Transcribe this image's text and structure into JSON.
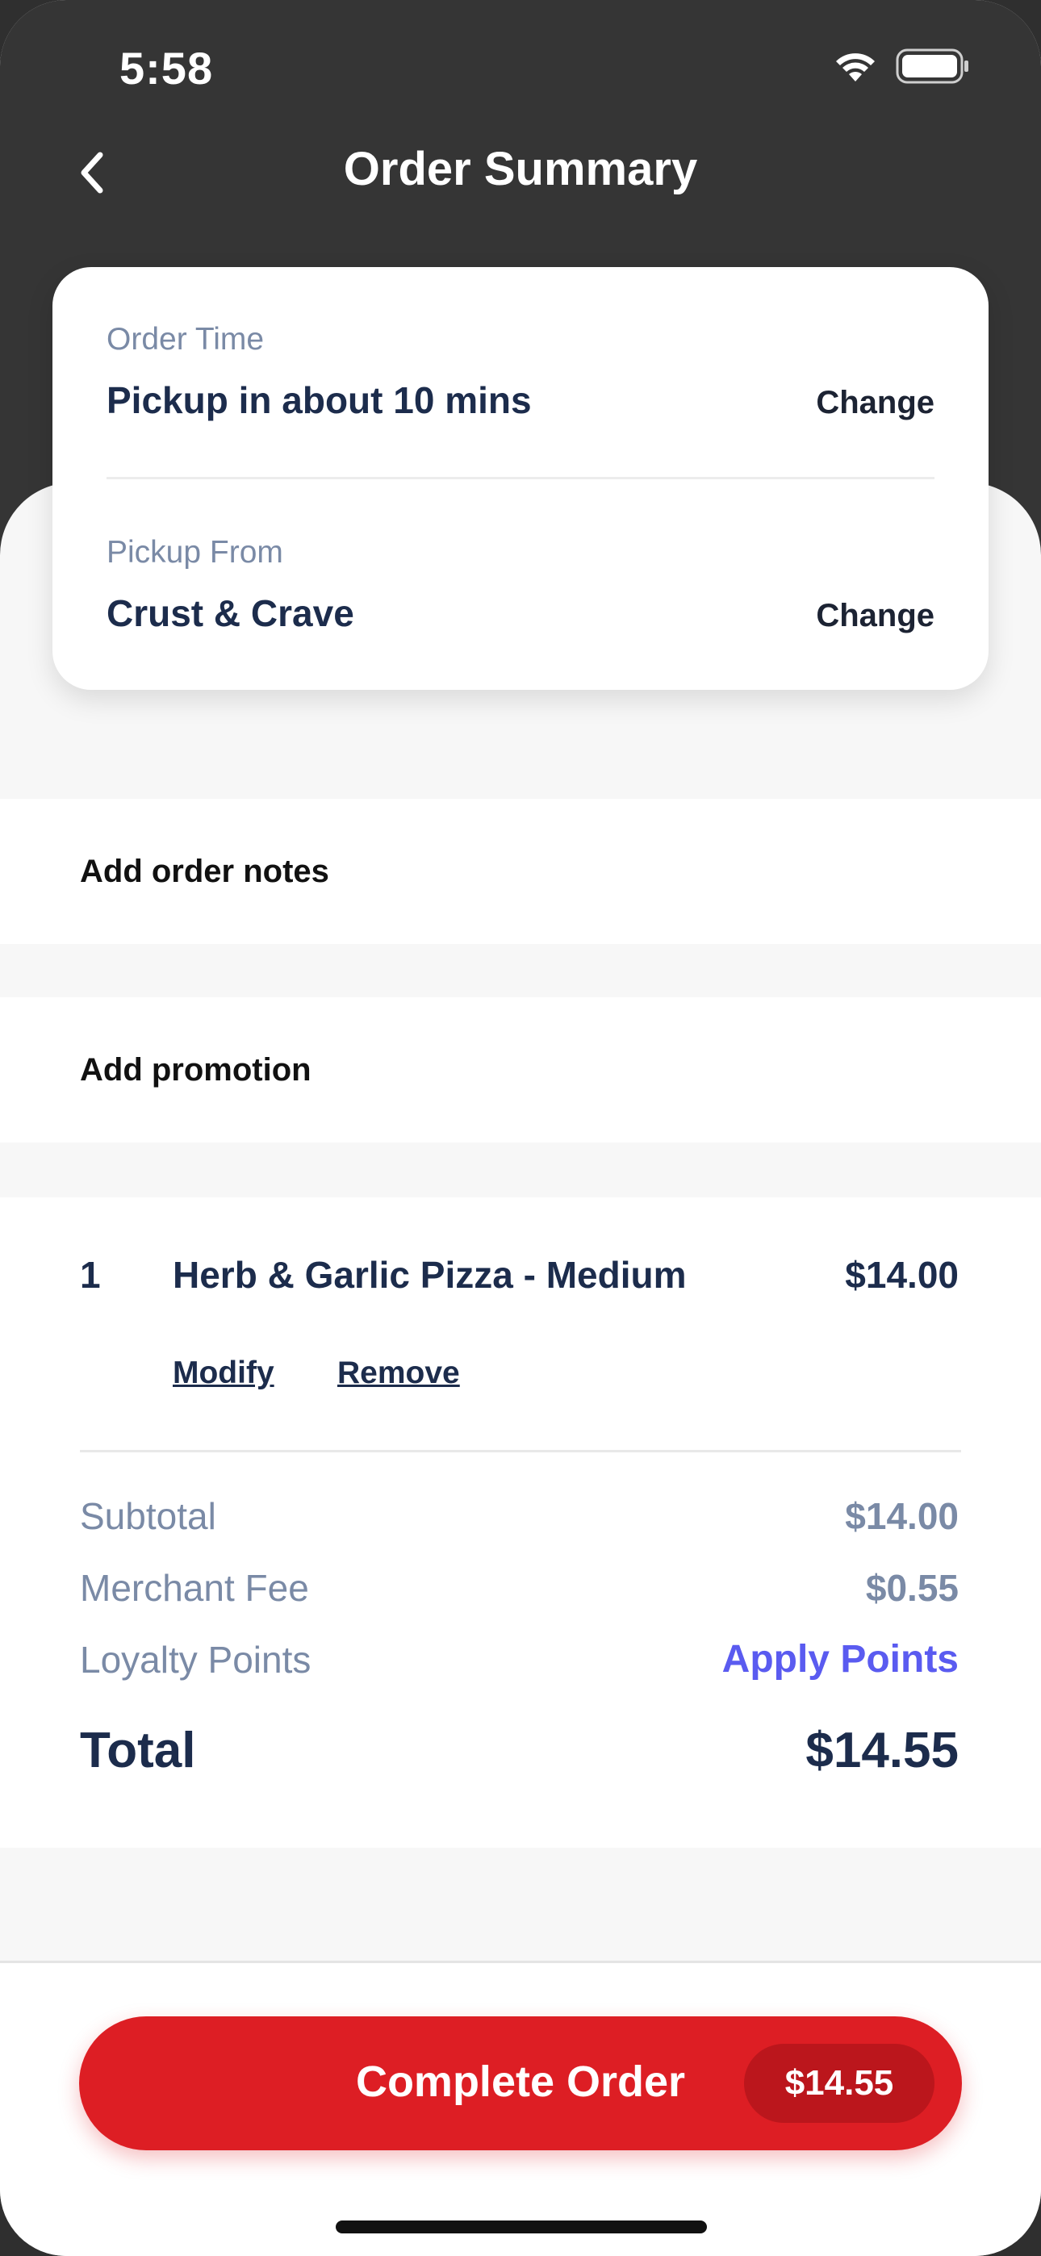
{
  "status_bar": {
    "time": "5:58",
    "icons": [
      "wifi-icon",
      "battery-icon"
    ]
  },
  "header": {
    "title": "Order Summary",
    "back_icon": "chevron-left-icon"
  },
  "order_card": {
    "time_label": "Order Time",
    "time_value": "Pickup in about 10 mins",
    "time_change": "Change",
    "location_label": "Pickup From",
    "location_value": "Crust & Crave",
    "location_change": "Change"
  },
  "rows": {
    "notes_label": "Add order notes",
    "promotion_label": "Add promotion"
  },
  "cart": {
    "items": [
      {
        "qty": "1",
        "name": "Herb & Garlic Pizza - Medium",
        "price": "$14.00",
        "modify_label": "Modify",
        "remove_label": "Remove"
      }
    ]
  },
  "summary": {
    "subtotal_label": "Subtotal",
    "subtotal_value": "$14.00",
    "fee_label": "Merchant Fee",
    "fee_value": "$0.55",
    "loyalty_label": "Loyalty Points",
    "loyalty_action": "Apply Points",
    "total_label": "Total",
    "total_value": "$14.55"
  },
  "footer": {
    "button_label": "Complete Order",
    "button_price": "$14.55"
  },
  "colors": {
    "header_bg": "#353535",
    "primary_text": "#1c2c4c",
    "muted_text": "#7a8aa6",
    "accent_red": "#dd1e24",
    "link_blue": "#5a5bf0"
  }
}
